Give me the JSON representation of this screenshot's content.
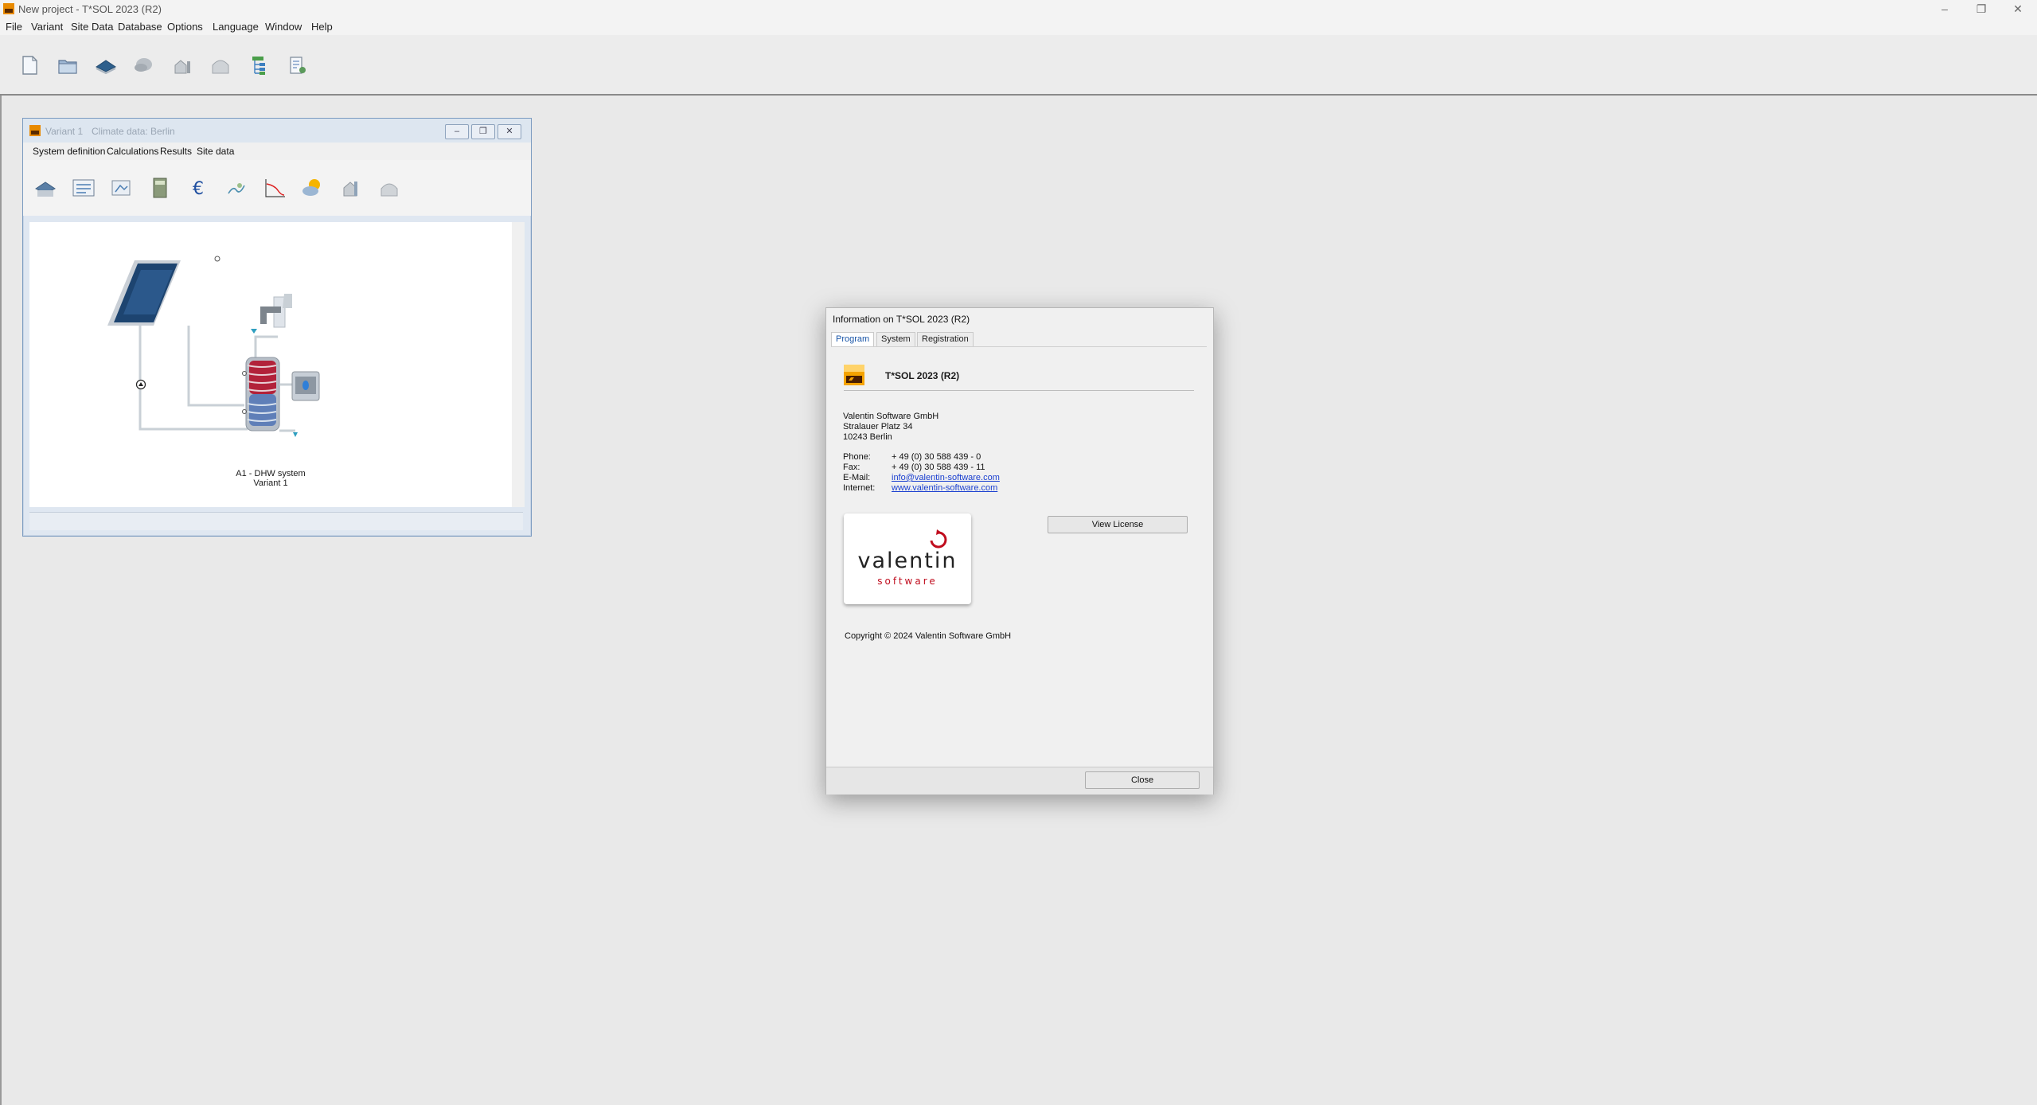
{
  "app": {
    "title": "New project - T*SOL 2023 (R2)"
  },
  "window_controls": {
    "minimize": "–",
    "restore": "❐",
    "close": "✕"
  },
  "menu": [
    "File",
    "Variant",
    "Site Data",
    "Database",
    "Options",
    "Language",
    "Window",
    "Help"
  ],
  "toolbar_icons": [
    "new-project-icon",
    "open-project-icon",
    "collector-icon",
    "climate-cloud-icon",
    "house-icon",
    "building-icon",
    "tree-structure-icon",
    "print-report-icon"
  ],
  "variant_window": {
    "title": "Variant 1",
    "climate": "Climate data: Berlin",
    "menu": [
      "System definition",
      "Calculations",
      "Results",
      "Site data"
    ],
    "toolbar_icons": [
      "system-selection-icon",
      "system-parameters-icon",
      "components-icon",
      "calculator-icon",
      "euro-icon",
      "diagram-icon",
      "curve-chart-icon",
      "weather-icon",
      "house-icon",
      "building-icon"
    ],
    "diagram_caption": "A1 - DHW system",
    "diagram_variant": "Variant 1"
  },
  "info_dialog": {
    "title": "Information on T*SOL 2023 (R2)",
    "tabs": [
      "Program",
      "System",
      "Registration"
    ],
    "active_tab": "Program",
    "program_name": "T*SOL 2023 (R2)",
    "company": "Valentin Software GmbH",
    "street": "Stralauer Platz 34",
    "city": "10243 Berlin",
    "contacts": [
      {
        "label": "Phone:",
        "value": "+ 49 (0) 30 588 439 - 0"
      },
      {
        "label": "Fax:",
        "value": "+ 49 (0) 30 588 439 - 11"
      },
      {
        "label": "E-Mail:",
        "value": "info@valentin-software.com"
      },
      {
        "label": "Internet:",
        "value": "www.valentin-software.com"
      }
    ],
    "logo_word": "valentin",
    "logo_sub": "software",
    "view_license_label": "View License",
    "copyright": "Copyright ©  2024  Valentin Software GmbH",
    "close_label": "Close"
  },
  "colors": {
    "accent_tab": "#1a56a8",
    "link": "#1a3fd0",
    "brand_red": "#c00d1e",
    "app_orange": "#e88a00"
  }
}
